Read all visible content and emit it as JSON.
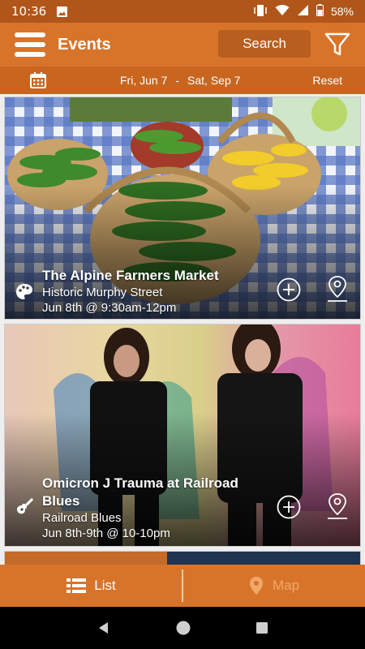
{
  "status_bar": {
    "time": "10:36",
    "battery": "58%"
  },
  "app_bar": {
    "title": "Events",
    "search_label": "Search"
  },
  "date_bar": {
    "start": "Fri, Jun 7",
    "separator": "-",
    "end": "Sat, Sep 7",
    "reset_label": "Reset"
  },
  "events": [
    {
      "title": "The Alpine Farmers Market",
      "venue": "Historic Murphy Street",
      "when": "Jun 8th @ 9:30am-12pm",
      "category_icon": "palette-icon"
    },
    {
      "title_line1": "Omicron J Trauma at Railroad",
      "title_line2": "Blues",
      "venue": "Railroad Blues",
      "when": "Jun 8th-9th @ 10-10pm",
      "category_icon": "guitar-icon"
    }
  ],
  "tabs": {
    "list_label": "List",
    "map_label": "Map"
  },
  "colors": {
    "app_bar": "#d8742a",
    "status_bar": "#b0561a",
    "date_bar": "#c8661f",
    "map_tab_inactive": "#f0a86a"
  }
}
